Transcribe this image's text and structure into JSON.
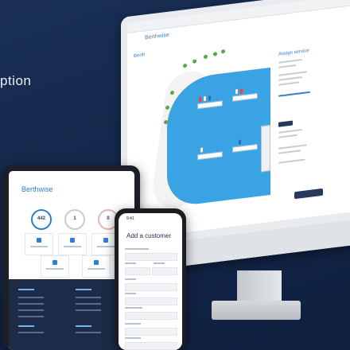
{
  "headline": "ption",
  "imac": {
    "logo": "Berthwise",
    "side_label": "Berth",
    "panel_title": "Assign service",
    "create_button": ""
  },
  "tablet": {
    "logo": "Berthwise",
    "stats": [
      {
        "value": "442"
      },
      {
        "value": "1"
      },
      {
        "value": "0"
      }
    ]
  },
  "phone": {
    "time": "9:41",
    "title": "Add a customer"
  },
  "colors": {
    "background": "#13264a",
    "accent": "#2f7fd1",
    "water": "#3aa3e4",
    "dark_navy": "#1d2b48"
  }
}
